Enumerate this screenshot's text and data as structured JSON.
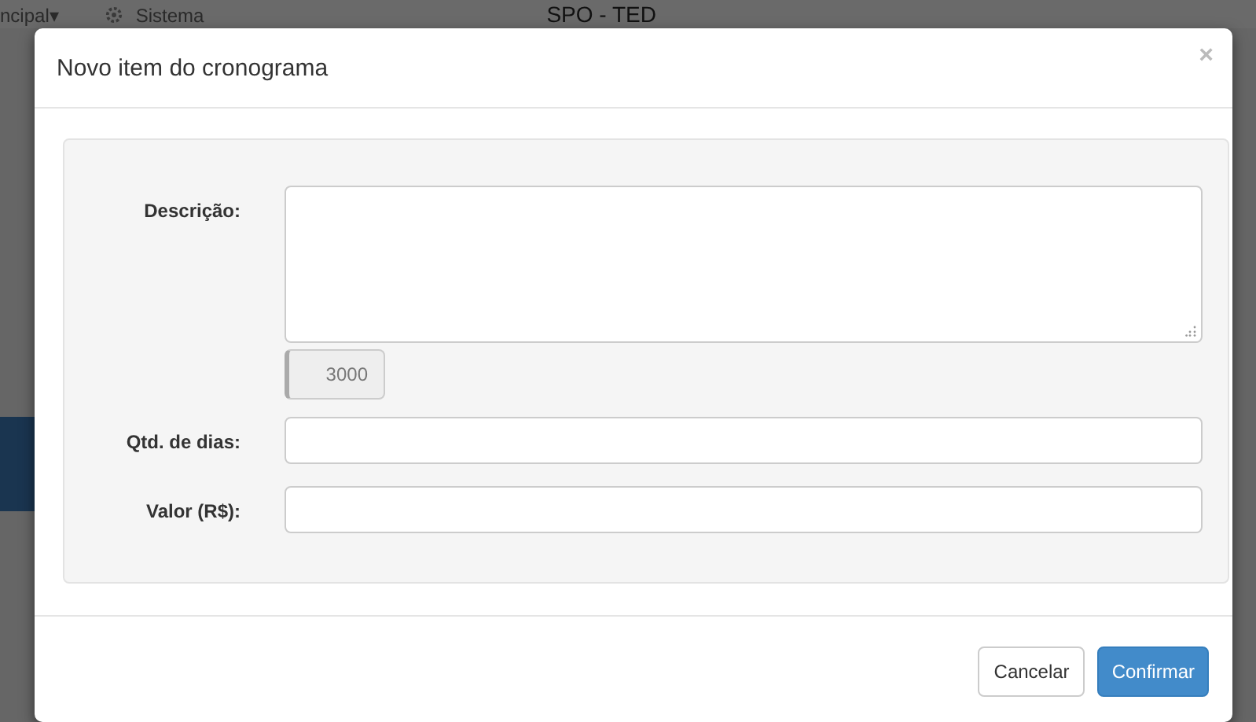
{
  "background_page": {
    "menu_items": [
      "ncipal▾",
      "Sistema"
    ],
    "heading": "SPO - TED"
  },
  "modal": {
    "title": "Novo item do cronograma",
    "close": "×",
    "fields": [
      {
        "label": "Descrição:",
        "kind": "textarea",
        "counter": "3000"
      },
      {
        "label": "Qtd. de dias:",
        "kind": "input"
      },
      {
        "label": "Valor (R$):",
        "kind": "input"
      }
    ],
    "buttons": [
      {
        "label": "Cancelar",
        "kind": "default"
      },
      {
        "label": "Confirmar",
        "kind": "primary"
      }
    ]
  }
}
